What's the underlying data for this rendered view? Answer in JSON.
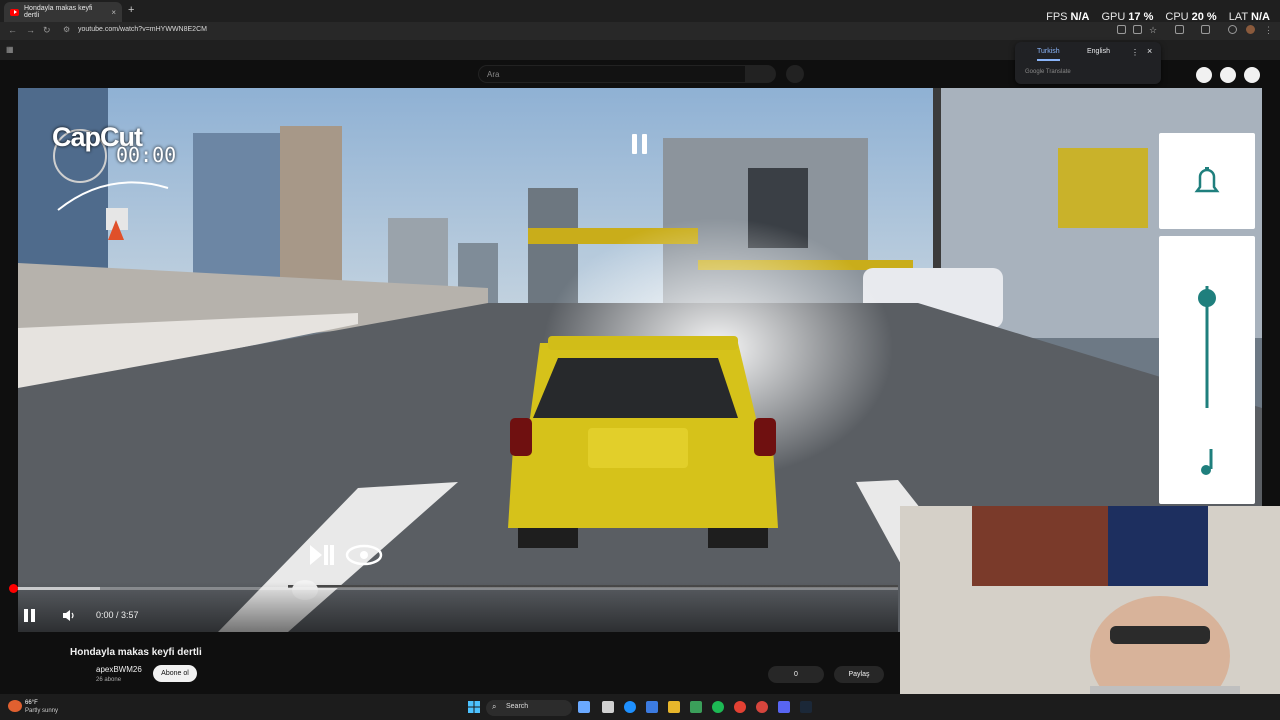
{
  "browser": {
    "tab_title": "Hondayla makas keyfi dertli",
    "tab_close": "×",
    "new_tab": "+",
    "url": "youtube.com/watch?v=mHYWWN8E2CM"
  },
  "overlay_hud": {
    "fps_label": "FPS",
    "fps_value": "N/A",
    "gpu_label": "GPU",
    "gpu_value": "17 %",
    "cpu_label": "CPU",
    "cpu_value": "20 %",
    "lat_label": "LAT",
    "lat_value": "N/A"
  },
  "youtube": {
    "search_placeholder": "Ara"
  },
  "translate_popup": {
    "lang_source": "Turkish",
    "lang_target": "English",
    "footer": "Google Translate",
    "close": "×"
  },
  "video_overlay": {
    "capcut_logo": "CapCut",
    "capcut_timer": "00:00"
  },
  "player": {
    "time": "0:00 / 3:57",
    "progress_played": 0.0,
    "progress_loaded": 0.1
  },
  "video_info": {
    "title": "Hondayla makas keyfi dertli",
    "channel": "apexBWM26",
    "subscribers": "26 abone",
    "subscribe_label": "Abone ol",
    "likes": "0",
    "share_label": "Paylaş"
  },
  "taskbar": {
    "temp": "66°F",
    "weather": "Partly sunny",
    "search_label": "Search"
  },
  "colors": {
    "accent_teal": "#1f7f7d",
    "youtube_red": "#ff0000",
    "car_yellow": "#d6c21a"
  }
}
